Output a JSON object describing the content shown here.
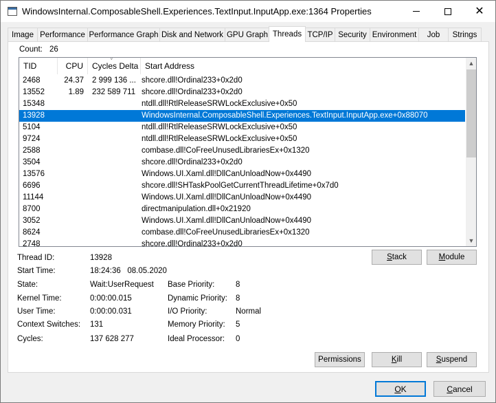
{
  "window": {
    "title": "WindowsInternal.ComposableShell.Experiences.TextInput.InputApp.exe:1364 Properties"
  },
  "tabs": [
    "Image",
    "Performance",
    "Performance Graph",
    "Disk and Network",
    "GPU Graph",
    "Threads",
    "TCP/IP",
    "Security",
    "Environment",
    "Job",
    "Strings"
  ],
  "active_tab": "Threads",
  "count": {
    "label": "Count:",
    "value": "26"
  },
  "columns": [
    "TID",
    "CPU",
    "Cycles Delta",
    "Start Address"
  ],
  "rows": [
    {
      "tid": "2468",
      "cpu": "24.37",
      "cycles": "2 999 136 ...",
      "address": "shcore.dll!Ordinal233+0x2d0"
    },
    {
      "tid": "13552",
      "cpu": "1.89",
      "cycles": "232 589 711",
      "address": "shcore.dll!Ordinal233+0x2d0"
    },
    {
      "tid": "15348",
      "cpu": "",
      "cycles": "",
      "address": "ntdll.dll!RtlReleaseSRWLockExclusive+0x50"
    },
    {
      "tid": "13928",
      "cpu": "",
      "cycles": "",
      "address": "WindowsInternal.ComposableShell.Experiences.TextInput.InputApp.exe+0x88070"
    },
    {
      "tid": "5104",
      "cpu": "",
      "cycles": "",
      "address": "ntdll.dll!RtlReleaseSRWLockExclusive+0x50"
    },
    {
      "tid": "9724",
      "cpu": "",
      "cycles": "",
      "address": "ntdll.dll!RtlReleaseSRWLockExclusive+0x50"
    },
    {
      "tid": "2588",
      "cpu": "",
      "cycles": "",
      "address": "combase.dll!CoFreeUnusedLibrariesEx+0x1320"
    },
    {
      "tid": "3504",
      "cpu": "",
      "cycles": "",
      "address": "shcore.dll!Ordinal233+0x2d0"
    },
    {
      "tid": "13576",
      "cpu": "",
      "cycles": "",
      "address": "Windows.UI.Xaml.dll!DllCanUnloadNow+0x4490"
    },
    {
      "tid": "6696",
      "cpu": "",
      "cycles": "",
      "address": "shcore.dll!SHTaskPoolGetCurrentThreadLifetime+0x7d0"
    },
    {
      "tid": "11144",
      "cpu": "",
      "cycles": "",
      "address": "Windows.UI.Xaml.dll!DllCanUnloadNow+0x4490"
    },
    {
      "tid": "8700",
      "cpu": "",
      "cycles": "",
      "address": "directmanipulation.dll+0x21920"
    },
    {
      "tid": "3052",
      "cpu": "",
      "cycles": "",
      "address": "Windows.UI.Xaml.dll!DllCanUnloadNow+0x4490"
    },
    {
      "tid": "8624",
      "cpu": "",
      "cycles": "",
      "address": "combase.dll!CoFreeUnusedLibrariesEx+0x1320"
    },
    {
      "tid": "2748",
      "cpu": "",
      "cycles": "",
      "address": "shcore.dll!Ordinal233+0x2d0"
    }
  ],
  "selected_row_index": 3,
  "details": {
    "thread_id_label": "Thread ID:",
    "thread_id": "13928",
    "start_time_label": "Start Time:",
    "start_time": "18:24:36   08.05.2020",
    "state_label": "State:",
    "state": "Wait:UserRequest",
    "kernel_time_label": "Kernel Time:",
    "kernel_time": "0:00:00.015",
    "user_time_label": "User Time:",
    "user_time": "0:00:00.031",
    "context_switches_label": "Context Switches:",
    "context_switches": "131",
    "cycles_label": "Cycles:",
    "cycles": "137 628 277",
    "base_priority_label": "Base Priority:",
    "base_priority": "8",
    "dynamic_priority_label": "Dynamic Priority:",
    "dynamic_priority": "8",
    "io_priority_label": "I/O Priority:",
    "io_priority": "Normal",
    "memory_priority_label": "Memory Priority:",
    "memory_priority": "5",
    "ideal_processor_label": "Ideal Processor:",
    "ideal_processor": "0"
  },
  "buttons": {
    "stack": "Stack",
    "module": "Module",
    "permissions": "Permissions",
    "kill": "Kill",
    "suspend": "Suspend",
    "ok": "OK",
    "cancel": "Cancel"
  },
  "icons": {
    "app": "app-window-icon",
    "minimize": "minimize-icon",
    "maximize": "maximize-icon",
    "close": "close-icon",
    "scroll_up": "scroll-up-icon",
    "scroll_down": "scroll-down-icon",
    "sort": "sort-arrow-icon"
  },
  "colors": {
    "selection": "#0078d7",
    "panel": "#ffffff",
    "chrome": "#f0f0f0"
  }
}
